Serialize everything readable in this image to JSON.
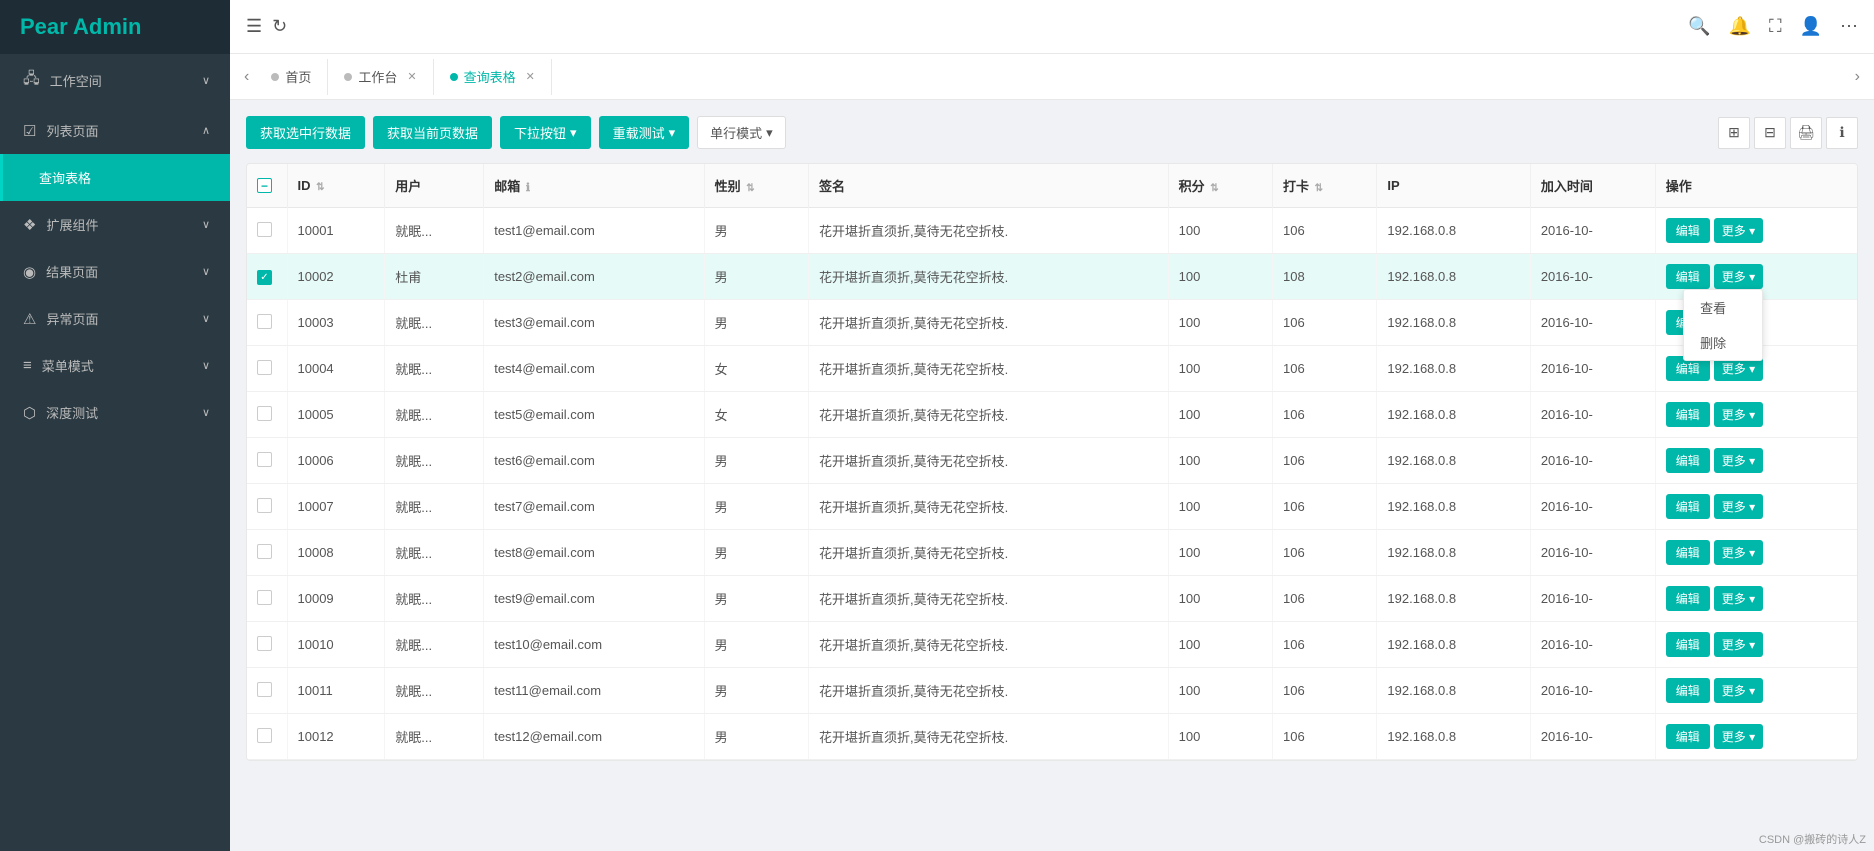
{
  "sidebar": {
    "logo": "Pear Admin",
    "items": [
      {
        "id": "workspace",
        "label": "工作空间",
        "icon": "☰",
        "expandable": true,
        "expanded": false
      },
      {
        "id": "list-page",
        "label": "列表页面",
        "icon": "◎",
        "expandable": true,
        "expanded": true
      },
      {
        "id": "query-table",
        "label": "查询表格",
        "icon": "",
        "expandable": false,
        "active": true
      },
      {
        "id": "extension",
        "label": "扩展组件",
        "icon": "◈",
        "expandable": true,
        "expanded": false
      },
      {
        "id": "result-page",
        "label": "结果页面",
        "icon": "◉",
        "expandable": true,
        "expanded": false
      },
      {
        "id": "error-page",
        "label": "异常页面",
        "icon": "⚠",
        "expandable": true,
        "expanded": false
      },
      {
        "id": "menu-mode",
        "label": "菜单模式",
        "icon": "≡",
        "expandable": true,
        "expanded": false
      },
      {
        "id": "deep-test",
        "label": "深度测试",
        "icon": "⬡",
        "expandable": true,
        "expanded": false
      }
    ]
  },
  "header": {
    "menu_icon": "☰",
    "refresh_icon": "↻",
    "search_icon": "🔍",
    "bell_icon": "🔔",
    "expand_icon": "⛶",
    "user_icon": "👤",
    "more_icon": "⋯"
  },
  "tabs": {
    "prev_label": "‹",
    "next_label": "›",
    "items": [
      {
        "id": "home",
        "label": "首页",
        "closable": false,
        "active": false
      },
      {
        "id": "workspace",
        "label": "工作台",
        "closable": true,
        "active": false
      },
      {
        "id": "query-table",
        "label": "查询表格",
        "closable": true,
        "active": true
      }
    ]
  },
  "toolbar": {
    "btn_get_selected": "获取选中行数据",
    "btn_get_current": "获取当前页数据",
    "btn_dropdown": "下拉按钮",
    "btn_reload": "重载测试",
    "btn_mode": "单行模式",
    "icon_grid": "⊞",
    "icon_print": "🖨",
    "icon_print2": "⊟",
    "icon_info": "ℹ"
  },
  "table": {
    "columns": [
      {
        "id": "checkbox",
        "label": ""
      },
      {
        "id": "id",
        "label": "ID",
        "sortable": true
      },
      {
        "id": "user",
        "label": "用户"
      },
      {
        "id": "email",
        "label": "邮箱",
        "info": true
      },
      {
        "id": "gender",
        "label": "性别",
        "sortable": true
      },
      {
        "id": "signature",
        "label": "签名"
      },
      {
        "id": "score",
        "label": "积分",
        "sortable": true
      },
      {
        "id": "checkin",
        "label": "打卡",
        "sortable": true
      },
      {
        "id": "ip",
        "label": "IP"
      },
      {
        "id": "join_time",
        "label": "加入时间"
      },
      {
        "id": "action",
        "label": "操作"
      }
    ],
    "rows": [
      {
        "id": "10001",
        "user": "就眠...",
        "email": "test1@email.com",
        "gender": "男",
        "signature": "花开堪折直须折,莫待无花空折枝.",
        "score": 100,
        "checkin": 106,
        "ip": "192.168.0.8",
        "join_time": "2016-10-",
        "selected": false,
        "dropdown_open": false
      },
      {
        "id": "10002",
        "user": "杜甫",
        "email": "test2@email.com",
        "gender": "男",
        "signature": "花开堪折直须折,莫待无花空折枝.",
        "score": 100,
        "checkin": 108,
        "ip": "192.168.0.8",
        "join_time": "2016-10-",
        "selected": true,
        "dropdown_open": true
      },
      {
        "id": "10003",
        "user": "就眠...",
        "email": "test3@email.com",
        "gender": "男",
        "signature": "花开堪折直须折,莫待无花空折枝.",
        "score": 100,
        "checkin": 106,
        "ip": "192.168.0.8",
        "join_time": "2016-10-",
        "selected": false,
        "dropdown_open": false
      },
      {
        "id": "10004",
        "user": "就眠...",
        "email": "test4@email.com",
        "gender": "女",
        "signature": "花开堪折直须折,莫待无花空折枝.",
        "score": 100,
        "checkin": 106,
        "ip": "192.168.0.8",
        "join_time": "2016-10-",
        "selected": false,
        "dropdown_open": false
      },
      {
        "id": "10005",
        "user": "就眠...",
        "email": "test5@email.com",
        "gender": "女",
        "signature": "花开堪折直须折,莫待无花空折枝.",
        "score": 100,
        "checkin": 106,
        "ip": "192.168.0.8",
        "join_time": "2016-10-",
        "selected": false,
        "dropdown_open": false
      },
      {
        "id": "10006",
        "user": "就眠...",
        "email": "test6@email.com",
        "gender": "男",
        "signature": "花开堪折直须折,莫待无花空折枝.",
        "score": 100,
        "checkin": 106,
        "ip": "192.168.0.8",
        "join_time": "2016-10-",
        "selected": false,
        "dropdown_open": false
      },
      {
        "id": "10007",
        "user": "就眠...",
        "email": "test7@email.com",
        "gender": "男",
        "signature": "花开堪折直须折,莫待无花空折枝.",
        "score": 100,
        "checkin": 106,
        "ip": "192.168.0.8",
        "join_time": "2016-10-",
        "selected": false,
        "dropdown_open": false
      },
      {
        "id": "10008",
        "user": "就眠...",
        "email": "test8@email.com",
        "gender": "男",
        "signature": "花开堪折直须折,莫待无花空折枝.",
        "score": 100,
        "checkin": 106,
        "ip": "192.168.0.8",
        "join_time": "2016-10-",
        "selected": false,
        "dropdown_open": false
      },
      {
        "id": "10009",
        "user": "就眠...",
        "email": "test9@email.com",
        "gender": "男",
        "signature": "花开堪折直须折,莫待无花空折枝.",
        "score": 100,
        "checkin": 106,
        "ip": "192.168.0.8",
        "join_time": "2016-10-",
        "selected": false,
        "dropdown_open": false
      },
      {
        "id": "10010",
        "user": "就眠...",
        "email": "test10@email.com",
        "gender": "男",
        "signature": "花开堪折直须折,莫待无花空折枝.",
        "score": 100,
        "checkin": 106,
        "ip": "192.168.0.8",
        "join_time": "2016-10-",
        "selected": false,
        "dropdown_open": false
      },
      {
        "id": "10011",
        "user": "就眠...",
        "email": "test11@email.com",
        "gender": "男",
        "signature": "花开堪折直须折,莫待无花空折枝.",
        "score": 100,
        "checkin": 106,
        "ip": "192.168.0.8",
        "join_time": "2016-10-",
        "selected": false,
        "dropdown_open": false
      },
      {
        "id": "10012",
        "user": "就眠...",
        "email": "test12@email.com",
        "gender": "男",
        "signature": "花开堪折直须折,莫待无花空折枝.",
        "score": 100,
        "checkin": 106,
        "ip": "192.168.0.8",
        "join_time": "2016-10-",
        "selected": false,
        "dropdown_open": false
      }
    ],
    "dropdown_menu_items": [
      "查看",
      "删除"
    ]
  },
  "footer": {
    "note": "CSDN @搬砖的诗人Z"
  }
}
